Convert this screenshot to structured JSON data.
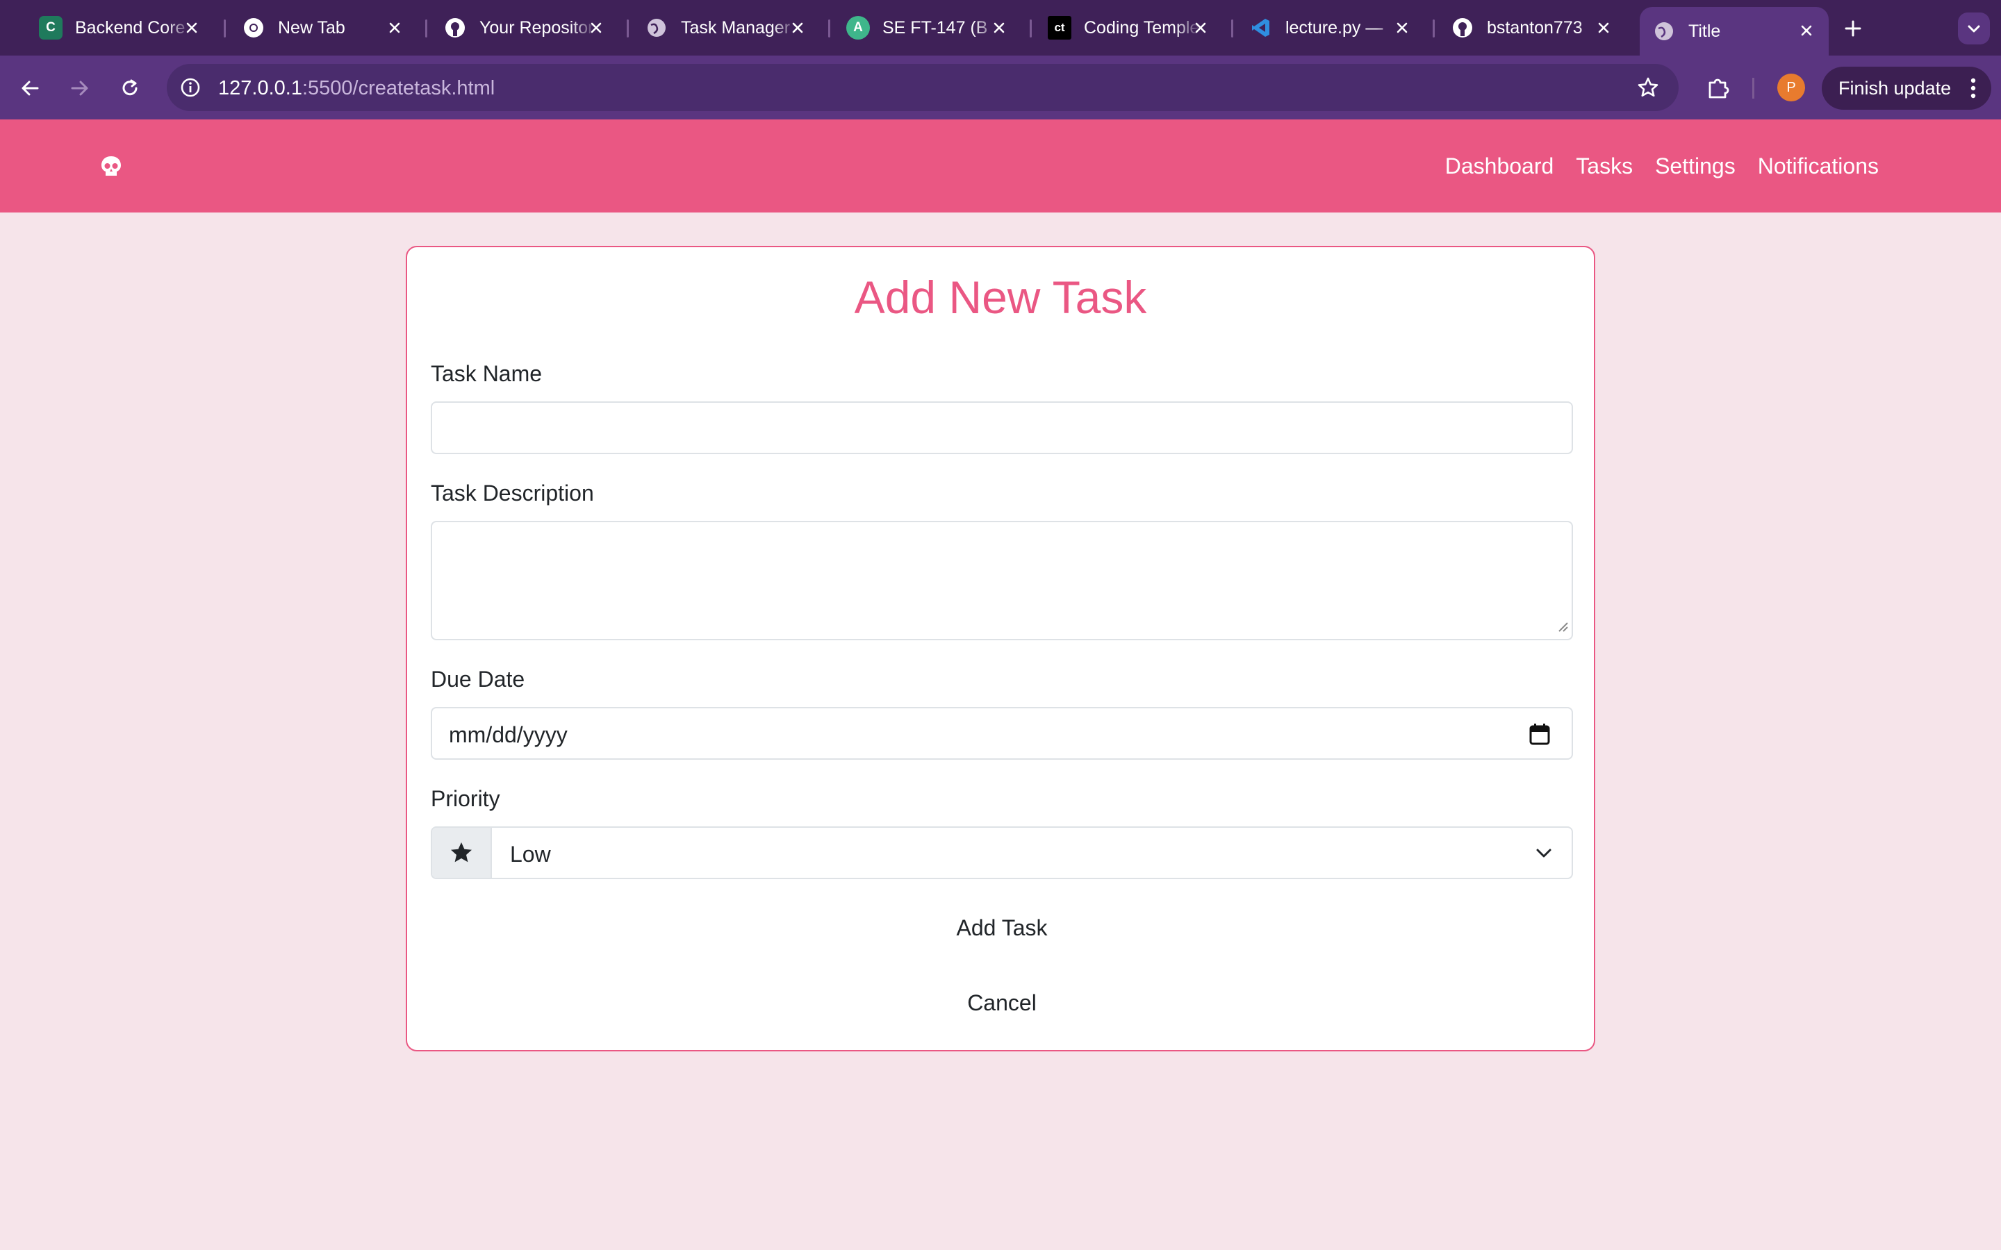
{
  "browser": {
    "tabs": [
      {
        "title": "Backend Core",
        "icon": "coding-temple-c-icon",
        "color": "#1f7a5c"
      },
      {
        "title": "New Tab",
        "icon": "chrome-icon",
        "color": "#ffffff"
      },
      {
        "title": "Your Repositories",
        "icon": "github-icon",
        "color": "#ffffff"
      },
      {
        "title": "Task Manager",
        "icon": "globe-icon",
        "color": "#cfc3da"
      },
      {
        "title": "SE FT-147 (B",
        "icon": "ai-assistant-icon",
        "color": "#3fb68b"
      },
      {
        "title": "Coding Temple",
        "icon": "ct-icon",
        "color": "#000000"
      },
      {
        "title": "lecture.py —",
        "icon": "vscode-icon",
        "color": "#2f8ee0"
      },
      {
        "title": "bstanton773",
        "icon": "github-icon",
        "color": "#ffffff"
      },
      {
        "title": "Title",
        "icon": "globe-icon",
        "color": "#cfc3da",
        "active": true
      }
    ],
    "url_host": "127.0.0.1",
    "url_rest": ":5500/createtask.html",
    "profile_initial": "P",
    "finish_update": "Finish update"
  },
  "navbar": {
    "links": [
      "Dashboard",
      "Tasks",
      "Settings",
      "Notifications"
    ],
    "color": "#ea5783"
  },
  "form": {
    "title": "Add New Task",
    "task_name_label": "Task Name",
    "task_name_value": "",
    "task_description_label": "Task Description",
    "task_description_value": "",
    "due_date_label": "Due Date",
    "due_date_placeholder": "mm/dd/yyyy",
    "priority_label": "Priority",
    "priority_value": "Low",
    "add_button": "Add Task",
    "cancel_button": "Cancel"
  }
}
